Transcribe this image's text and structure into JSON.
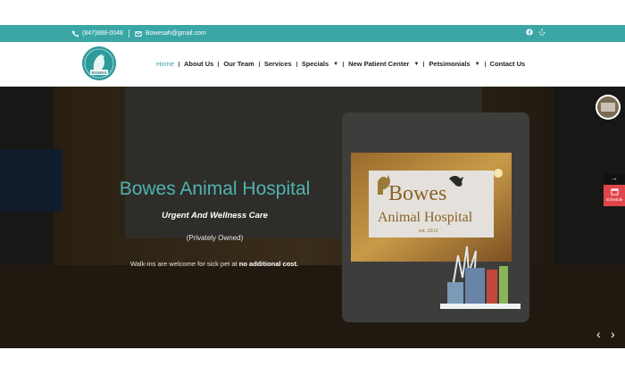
{
  "topbar": {
    "phone": "(847)888-0048",
    "email": "Bowesah@gmail.com",
    "social": [
      {
        "name": "facebook-icon"
      },
      {
        "name": "yelp-icon"
      }
    ]
  },
  "logo": {
    "text": "BOWES"
  },
  "nav": {
    "items": [
      {
        "label": "Home",
        "active": true,
        "dropdown": false
      },
      {
        "label": "About Us",
        "dropdown": false
      },
      {
        "label": "Our Team",
        "dropdown": false
      },
      {
        "label": "Services",
        "dropdown": false
      },
      {
        "label": "Specials",
        "dropdown": true
      },
      {
        "label": "New Patient Center",
        "dropdown": true
      },
      {
        "label": "Petsimonials",
        "dropdown": true
      },
      {
        "label": "Contact Us",
        "dropdown": false
      }
    ]
  },
  "hero": {
    "title": "Bowes Animal Hospital",
    "subtitle": "Urgent And Wellness Care",
    "ownership": "(Privately Owned)",
    "walkin_prefix": "Walk-ins are welcome for sick pet at ",
    "walkin_bold": "no additional cost.",
    "sign": {
      "line1": "Bowes",
      "line2": "Animal Hospital",
      "line3": "est. 2012"
    }
  },
  "sidebar": {
    "schedule_label": "Schedule"
  },
  "colors": {
    "teal": "#3aa6a6",
    "accent_red": "#e0454a"
  }
}
